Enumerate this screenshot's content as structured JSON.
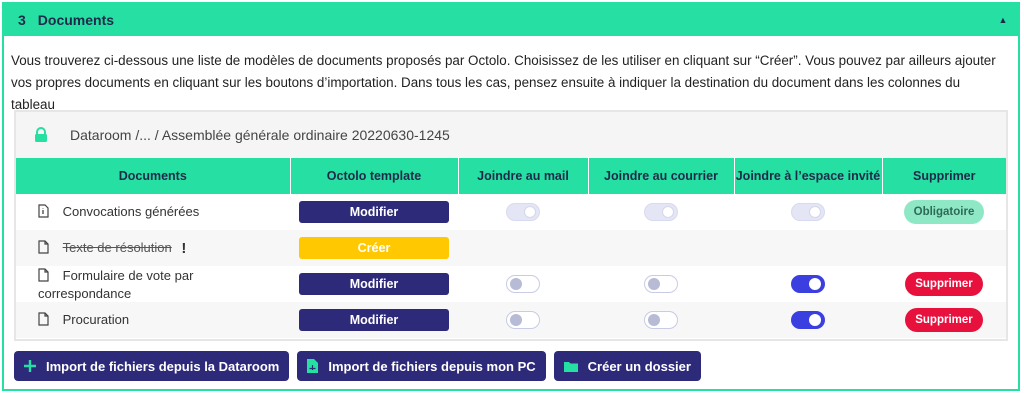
{
  "section": {
    "number": "3",
    "title": "Documents"
  },
  "intro": "Vous trouverez ci-dessous une liste de modèles de documents proposés par Octolo. Choisissez de les utiliser en cliquant sur “Créer”. Vous pouvez par ailleurs ajouter vos propres documents en cliquant sur les boutons d’importation. Dans tous les cas, pensez ensuite à indiquer la destination du document dans les colonnes du tableau",
  "dataroom": {
    "breadcrumb": "Dataroom /... / Assemblée générale ordinaire 20220630-1245"
  },
  "table": {
    "headers": {
      "documents": "Documents",
      "template": "Octolo template",
      "mail": "Joindre au mail",
      "courrier": "Joindre au courrier",
      "espace": "Joindre à l’espace invité",
      "supprimer": "Supprimer"
    },
    "rows": [
      {
        "name": "Convocations générées",
        "template_btn": "Modifier",
        "mail": "disabled-on",
        "courrier": "disabled-on",
        "espace": "disabled-on",
        "action": "Obligatoire"
      },
      {
        "name": "Texte de résolution",
        "template_btn": "Créer",
        "warning": "!"
      },
      {
        "name": "Formulaire de vote par correspondance",
        "template_btn": "Modifier",
        "mail": "off",
        "courrier": "off",
        "espace": "on",
        "action": "Supprimer"
      },
      {
        "name": "Procuration",
        "template_btn": "Modifier",
        "mail": "off",
        "courrier": "off",
        "espace": "on",
        "action": "Supprimer"
      }
    ]
  },
  "buttons": {
    "import_dataroom": "Import de fichiers depuis la Dataroom",
    "import_pc": "Import de fichiers depuis mon PC",
    "create_folder": "Créer un dossier"
  },
  "colors": {
    "accent": "#25dfa3",
    "primary": "#2d2a7a",
    "create": "#ffc800",
    "danger": "#e8103d",
    "toggle_on": "#3b3fe0"
  }
}
